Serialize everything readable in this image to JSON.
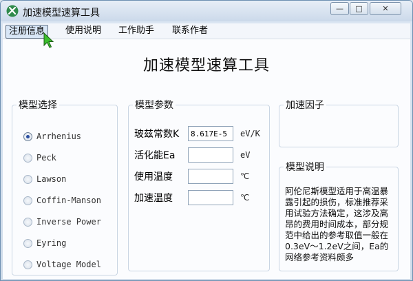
{
  "window": {
    "title": "加速模型速算工具",
    "minimize_glyph": "—",
    "maximize_glyph": "□",
    "close_glyph": "✕"
  },
  "menu": {
    "items": [
      {
        "label": "注册信息",
        "active": true
      },
      {
        "label": "使用说明"
      },
      {
        "label": "工作助手"
      },
      {
        "label": "联系作者"
      }
    ]
  },
  "main": {
    "heading": "加速模型速算工具"
  },
  "model_select": {
    "legend": "模型选择",
    "options": [
      {
        "label": "Arrhenius",
        "checked": true
      },
      {
        "label": "Peck"
      },
      {
        "label": "Lawson"
      },
      {
        "label": "Coffin-Manson"
      },
      {
        "label": "Inverse Power"
      },
      {
        "label": "Eyring"
      },
      {
        "label": "Voltage Model"
      }
    ]
  },
  "params": {
    "legend": "模型参数",
    "rows": [
      {
        "label": "玻兹常数K",
        "value": "8.617E-5",
        "unit": "eV/K"
      },
      {
        "label": "活化能Ea",
        "value": "",
        "unit": "eV"
      },
      {
        "label": "使用温度",
        "value": "",
        "unit": "℃"
      },
      {
        "label": "加速温度",
        "value": "",
        "unit": "℃"
      }
    ]
  },
  "factor": {
    "legend": "加速因子"
  },
  "description": {
    "legend": "模型说明",
    "text": "阿伦尼斯模型适用于高温暴露引起的损伤，标准推荐采用试验方法确定，这涉及高昂的费用时间成本，部分规范中给出的参考取值一般在0.3eV～1.2eV之间，Ea的网络参考资料颇多"
  },
  "colors": {
    "titlebar": "#cbd9ea",
    "client_bg": "#fbfcfe",
    "group_border": "#c9d5e3",
    "radio_dot": "#2a4ea0"
  },
  "icons": {
    "app": "tools-icon",
    "cursor": "mouse-pointer-icon"
  }
}
